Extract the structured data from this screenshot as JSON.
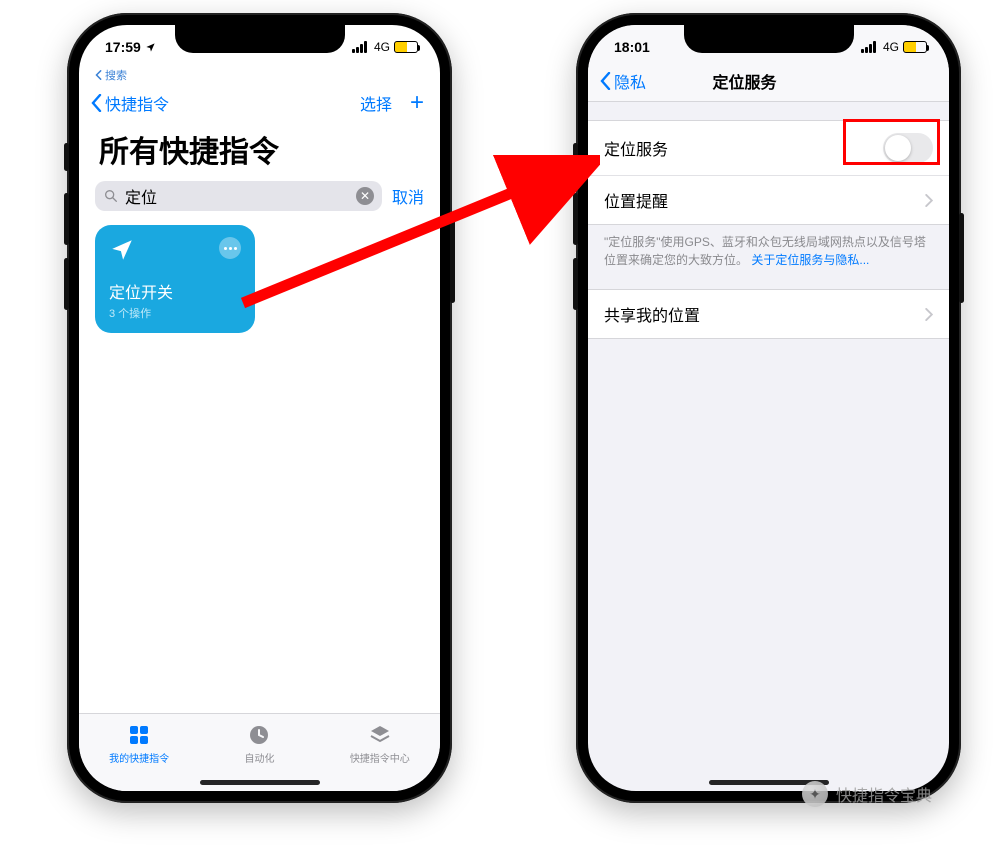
{
  "left": {
    "status": {
      "time": "17:59",
      "network": "4G",
      "breadcrumb": "搜索"
    },
    "nav": {
      "back": "快捷指令",
      "select": "选择"
    },
    "title": "所有快捷指令",
    "search": {
      "value": "定位",
      "cancel": "取消"
    },
    "card": {
      "title": "定位开关",
      "subtitle": "3 个操作"
    },
    "tabs": {
      "shortcuts": "我的快捷指令",
      "automation": "自动化",
      "gallery": "快捷指令中心"
    }
  },
  "right": {
    "status": {
      "time": "18:01",
      "network": "4G"
    },
    "nav": {
      "back": "隐私",
      "title": "定位服务"
    },
    "rows": {
      "location_services": "定位服务",
      "location_alerts": "位置提醒",
      "share_location": "共享我的位置"
    },
    "footer_text": "\"定位服务\"使用GPS、蓝牙和众包无线局域网热点以及信号塔位置来确定您的大致方位。",
    "footer_link": "关于定位服务与隐私..."
  },
  "watermark": "快捷指令宝典"
}
